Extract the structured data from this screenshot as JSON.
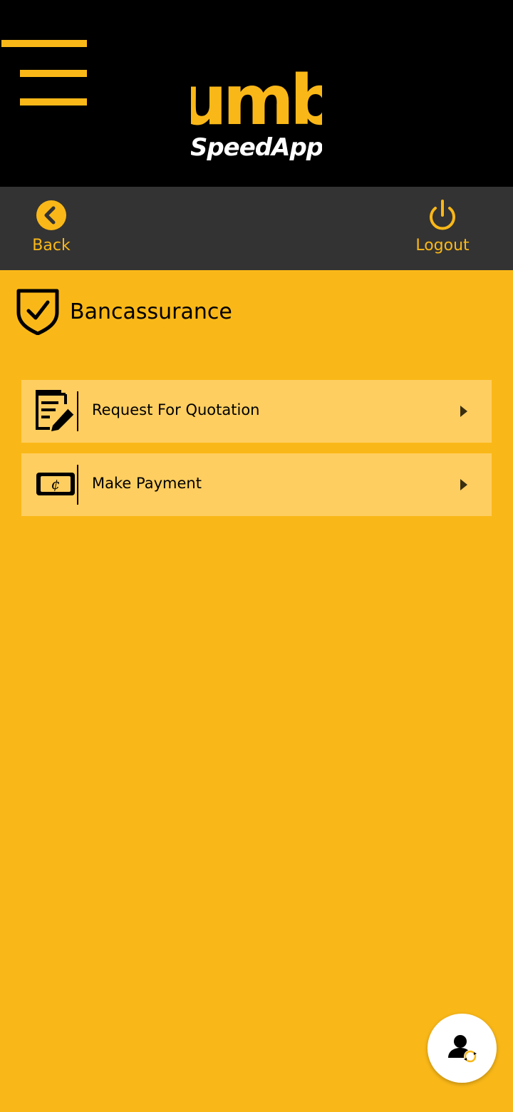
{
  "header": {
    "logo_text": "umb",
    "logo_subtitle": "SpeedApp",
    "menu_icon": "hamburger-menu-icon"
  },
  "navbar": {
    "back_label": "Back",
    "back_icon": "chevron-left-circle-icon",
    "logout_label": "Logout",
    "logout_icon": "power-icon"
  },
  "section": {
    "title": "Bancassurance",
    "icon": "shield-check-icon"
  },
  "items": [
    {
      "label": "Request For Quotation",
      "icon": "notepad-pen-icon"
    },
    {
      "label": "Make Payment",
      "icon": "cedi-bill-icon"
    }
  ],
  "fab": {
    "icon": "user-switch-icon"
  },
  "colors": {
    "brand_yellow": "#FAB818",
    "item_background": "#FFCE60",
    "navbar": "#333333",
    "header": "#000000"
  }
}
